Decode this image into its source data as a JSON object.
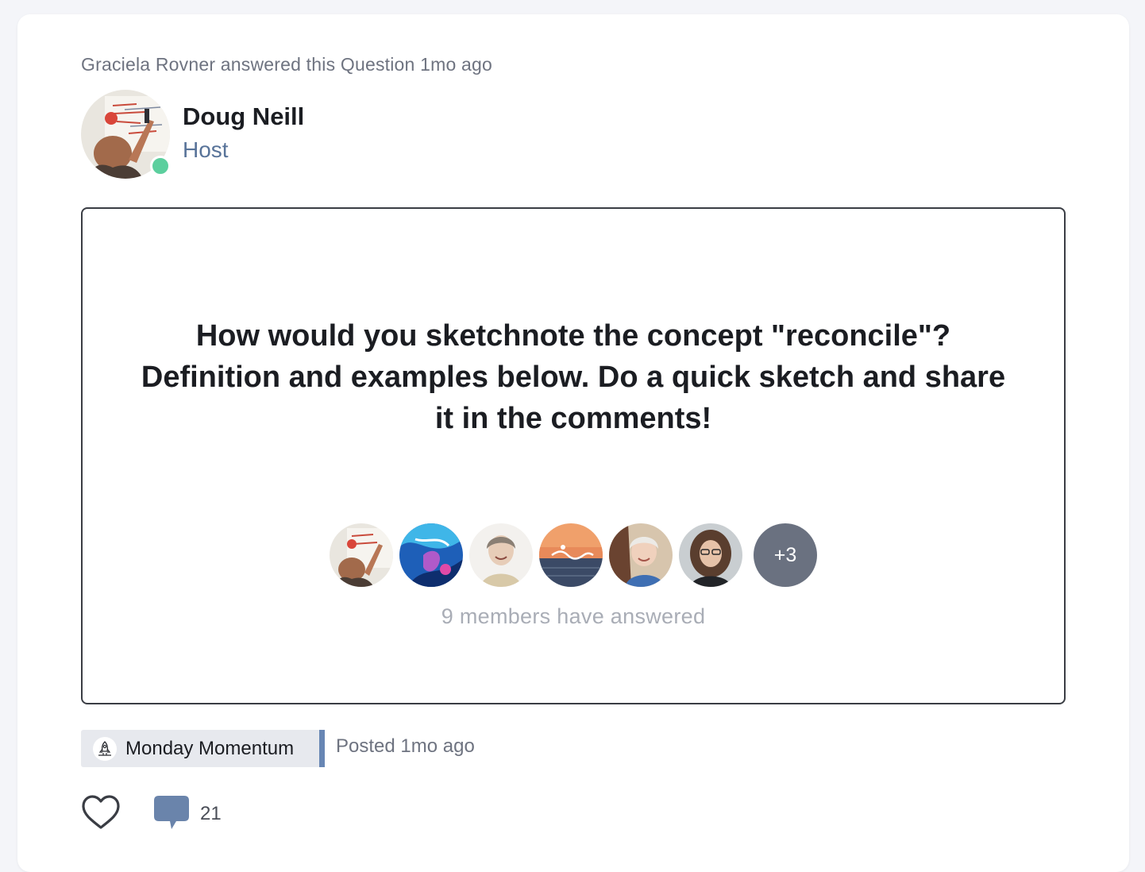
{
  "activity": {
    "text": "Graciela Rovner answered this Question 1mo ago"
  },
  "author": {
    "name": "Doug Neill",
    "role": "Host",
    "status": "online",
    "avatar_icon": "whiteboard-photo"
  },
  "question": {
    "text": "How would you sketchnote the concept \"reconcile\"? Definition and examples below. Do a quick sketch and share it in the comments!"
  },
  "answerers": {
    "avatars": [
      "whiteboard-photo",
      "blue-abstract-art",
      "smiling-woman-photo",
      "sunset-swimmer-logo",
      "woman-with-horse-photo",
      "curly-hair-woman-photo"
    ],
    "more_label": "+3",
    "summary": "9 members have answered"
  },
  "space": {
    "name": "Monday Momentum",
    "icon": "rocket-icon"
  },
  "posted": "Posted 1mo ago",
  "engagement": {
    "comment_count": "21"
  },
  "colors": {
    "host": "#587399",
    "online": "#5ccf9e",
    "space_accent": "#6786b4",
    "comment_icon": "#6a84ab"
  }
}
